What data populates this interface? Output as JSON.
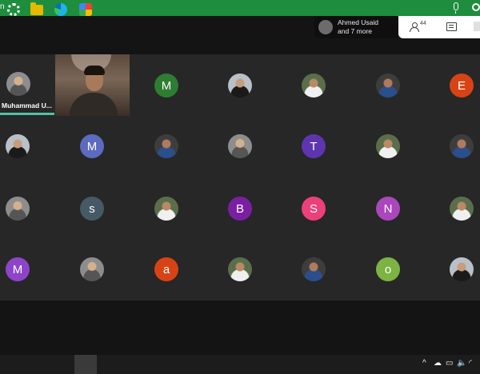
{
  "top_bar": {
    "left_text": "n",
    "color": "#1e8e3e",
    "mic_icon": "mic-icon",
    "hangup_icon": "hangup-icon"
  },
  "presenter_chip": {
    "line1": "Ahmed Usaid",
    "line2": "and 7 more"
  },
  "right_panel": {
    "people_count": "44",
    "people_icon": "people-icon",
    "chat_icon": "chat-icon"
  },
  "speaker_tile": {
    "name": "Muhammad U..."
  },
  "participants": [
    {
      "kind": "initial",
      "letter": "M",
      "color": "#2e7d32"
    },
    {
      "kind": "photo"
    },
    {
      "kind": "photo"
    },
    {
      "kind": "photo"
    },
    {
      "kind": "initial",
      "letter": "E",
      "color": "#d84315"
    },
    {
      "kind": "photo"
    },
    {
      "kind": "initial",
      "letter": "M",
      "color": "#5c6bc0"
    },
    {
      "kind": "photo"
    },
    {
      "kind": "photo"
    },
    {
      "kind": "initial",
      "letter": "T",
      "color": "#5e35b1"
    },
    {
      "kind": "photo"
    },
    {
      "kind": "photo"
    },
    {
      "kind": "photo"
    },
    {
      "kind": "initial",
      "letter": "s",
      "color": "#455a64"
    },
    {
      "kind": "photo"
    },
    {
      "kind": "initial",
      "letter": "B",
      "color": "#7b1fa2"
    },
    {
      "kind": "initial",
      "letter": "S",
      "color": "#ec407a"
    },
    {
      "kind": "initial",
      "letter": "N",
      "color": "#ab47bc"
    },
    {
      "kind": "photo"
    },
    {
      "kind": "initial",
      "letter": "M",
      "color": "#8e44c9"
    },
    {
      "kind": "photo"
    },
    {
      "kind": "initial",
      "letter": "a",
      "color": "#d84315"
    },
    {
      "kind": "photo"
    },
    {
      "kind": "photo"
    },
    {
      "kind": "initial",
      "letter": "o",
      "color": "#7cb342"
    },
    {
      "kind": "photo"
    }
  ],
  "taskbar": {
    "icons": [
      "settings-icon",
      "file-explorer-icon",
      "edge-icon",
      "google-meet-icon"
    ],
    "tray": [
      "chevron-up-icon",
      "cloud-icon",
      "battery-icon",
      "volume-icon",
      "wifi-icon"
    ]
  }
}
